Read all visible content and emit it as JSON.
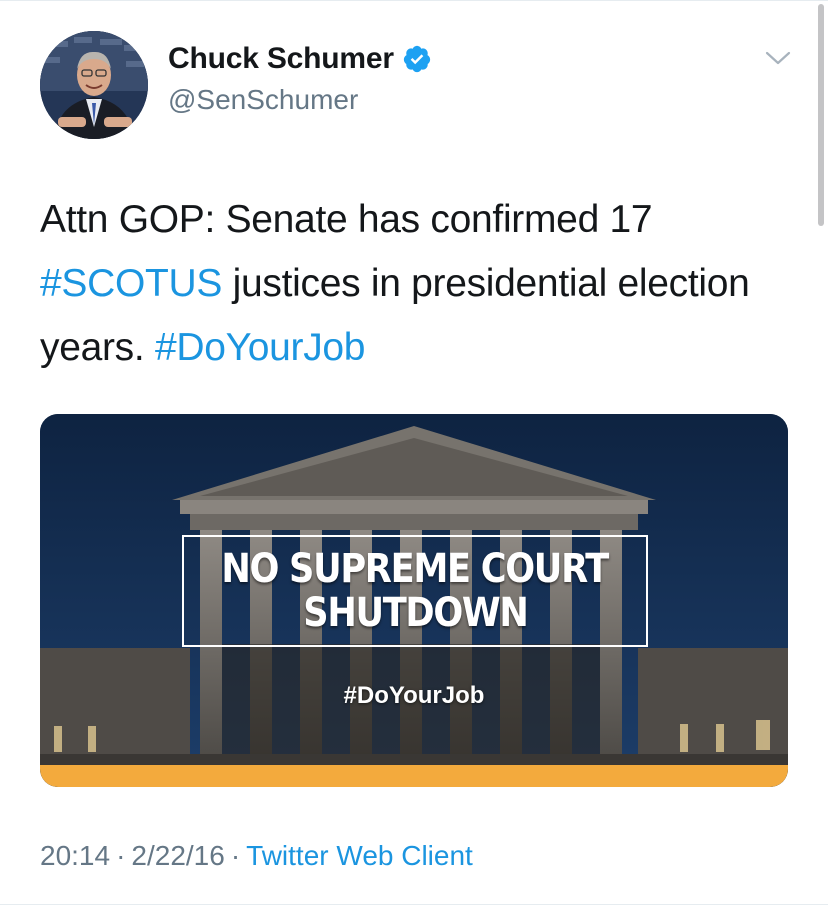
{
  "author": {
    "display_name": "Chuck Schumer",
    "handle": "@SenSchumer",
    "verified": true
  },
  "tweet": {
    "text_parts": [
      {
        "text": "Attn GOP: Senate has confirmed 17 ",
        "type": "text"
      },
      {
        "text": "#SCOTUS",
        "type": "hashtag"
      },
      {
        "text": " justices in presidential election years. ",
        "type": "text"
      },
      {
        "text": "#DoYourJob",
        "type": "hashtag"
      }
    ]
  },
  "card": {
    "headline_line1": "NO SUPREME COURT",
    "headline_line2": "SHUTDOWN",
    "hashtag": "#DoYourJob"
  },
  "meta": {
    "time": "20:14",
    "date": "2/22/16",
    "separator": "·",
    "source": "Twitter Web Client"
  },
  "icons": {
    "verified": "verified-badge-icon",
    "menu": "chevron-down-icon"
  },
  "colors": {
    "hashtag": "#1b95e0",
    "text": "#14171a",
    "secondary": "#657786",
    "verified": "#1da1f2",
    "card_band": "#f3aa3d",
    "card_sky": "#0f2542"
  }
}
